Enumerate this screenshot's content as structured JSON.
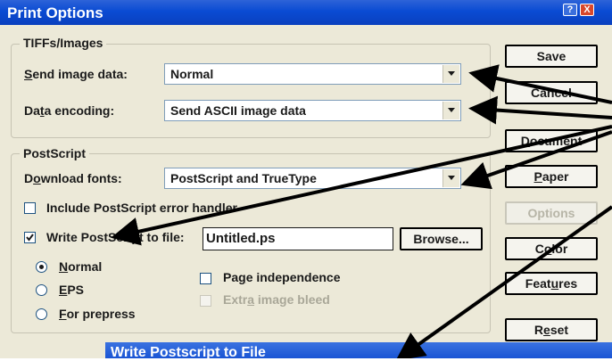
{
  "window": {
    "title": "Print Options"
  },
  "tiffs": {
    "group_label": "TIFFs/Images",
    "send_image_data": {
      "label": "Send image data:",
      "value": "Normal"
    },
    "data_encoding": {
      "label": "Data encoding:",
      "value": "Send ASCII image data"
    }
  },
  "postscript": {
    "group_label": "PostScript",
    "download_fonts": {
      "label": "Download fonts:",
      "value": "PostScript and TrueType"
    },
    "include_error_handler": {
      "label": "Include PostScript error handler",
      "checked": false
    },
    "write_to_file": {
      "label": "Write PostScript to file:",
      "checked": true,
      "filename": "Untitled.ps",
      "browse_label": "Browse..."
    },
    "modes": [
      {
        "label": "Normal",
        "selected": true
      },
      {
        "label": "EPS",
        "selected": false
      },
      {
        "label": "For prepress",
        "selected": false
      }
    ],
    "page_independence": {
      "label": "Page independence",
      "checked": false
    },
    "extra_image_bleed": {
      "label": "Extra image bleed",
      "checked": false,
      "enabled": false
    }
  },
  "buttons": {
    "save": "Save",
    "cancel": "Cancel",
    "document": "Document",
    "paper": "Paper",
    "options": "Options",
    "color": "Color",
    "features": "Features",
    "reset": "Reset"
  },
  "dialog2": {
    "title": "Write Postscript to File",
    "help": "?",
    "close": "X"
  },
  "icons": {
    "dropdown": "chevron-down-icon",
    "check": "checkmark-icon",
    "help": "question-icon",
    "close": "close-icon"
  }
}
